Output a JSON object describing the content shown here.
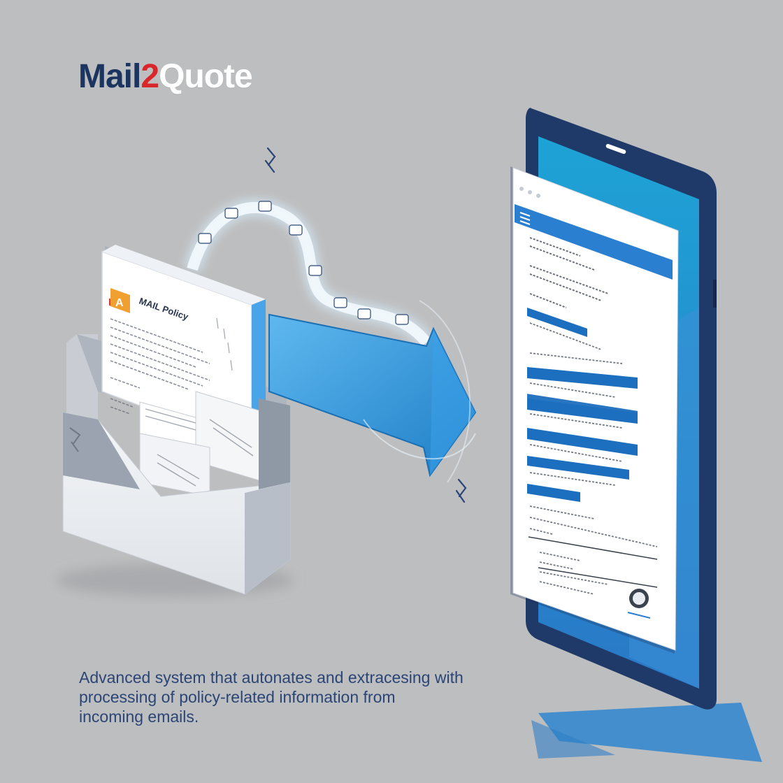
{
  "brand": {
    "part1": "Mail",
    "part2": "2",
    "part3": "Quote",
    "colors": {
      "part1": "#1c3460",
      "part2": "#d9262b",
      "part3": "#ffffff"
    }
  },
  "email_document": {
    "subject": "MAIL Policy"
  },
  "caption": {
    "line1": "Advanced system that autonates and extracesing with",
    "line2": "processing of policy-related information from",
    "line3": "incoming emails."
  },
  "colors": {
    "background": "#bdbebf",
    "arrow": "#2f8fd6",
    "phone_frame": "#1f3a68",
    "phone_screen": "#1f9bd1",
    "highlight_bar": "#1c6fbf",
    "alert_icon": "#f0a030"
  },
  "icons": [
    "inbox-tray-icon",
    "alert-icon",
    "arrow-right-icon",
    "phone-icon",
    "menu-icon",
    "seal-icon",
    "data-stream-icon"
  ]
}
